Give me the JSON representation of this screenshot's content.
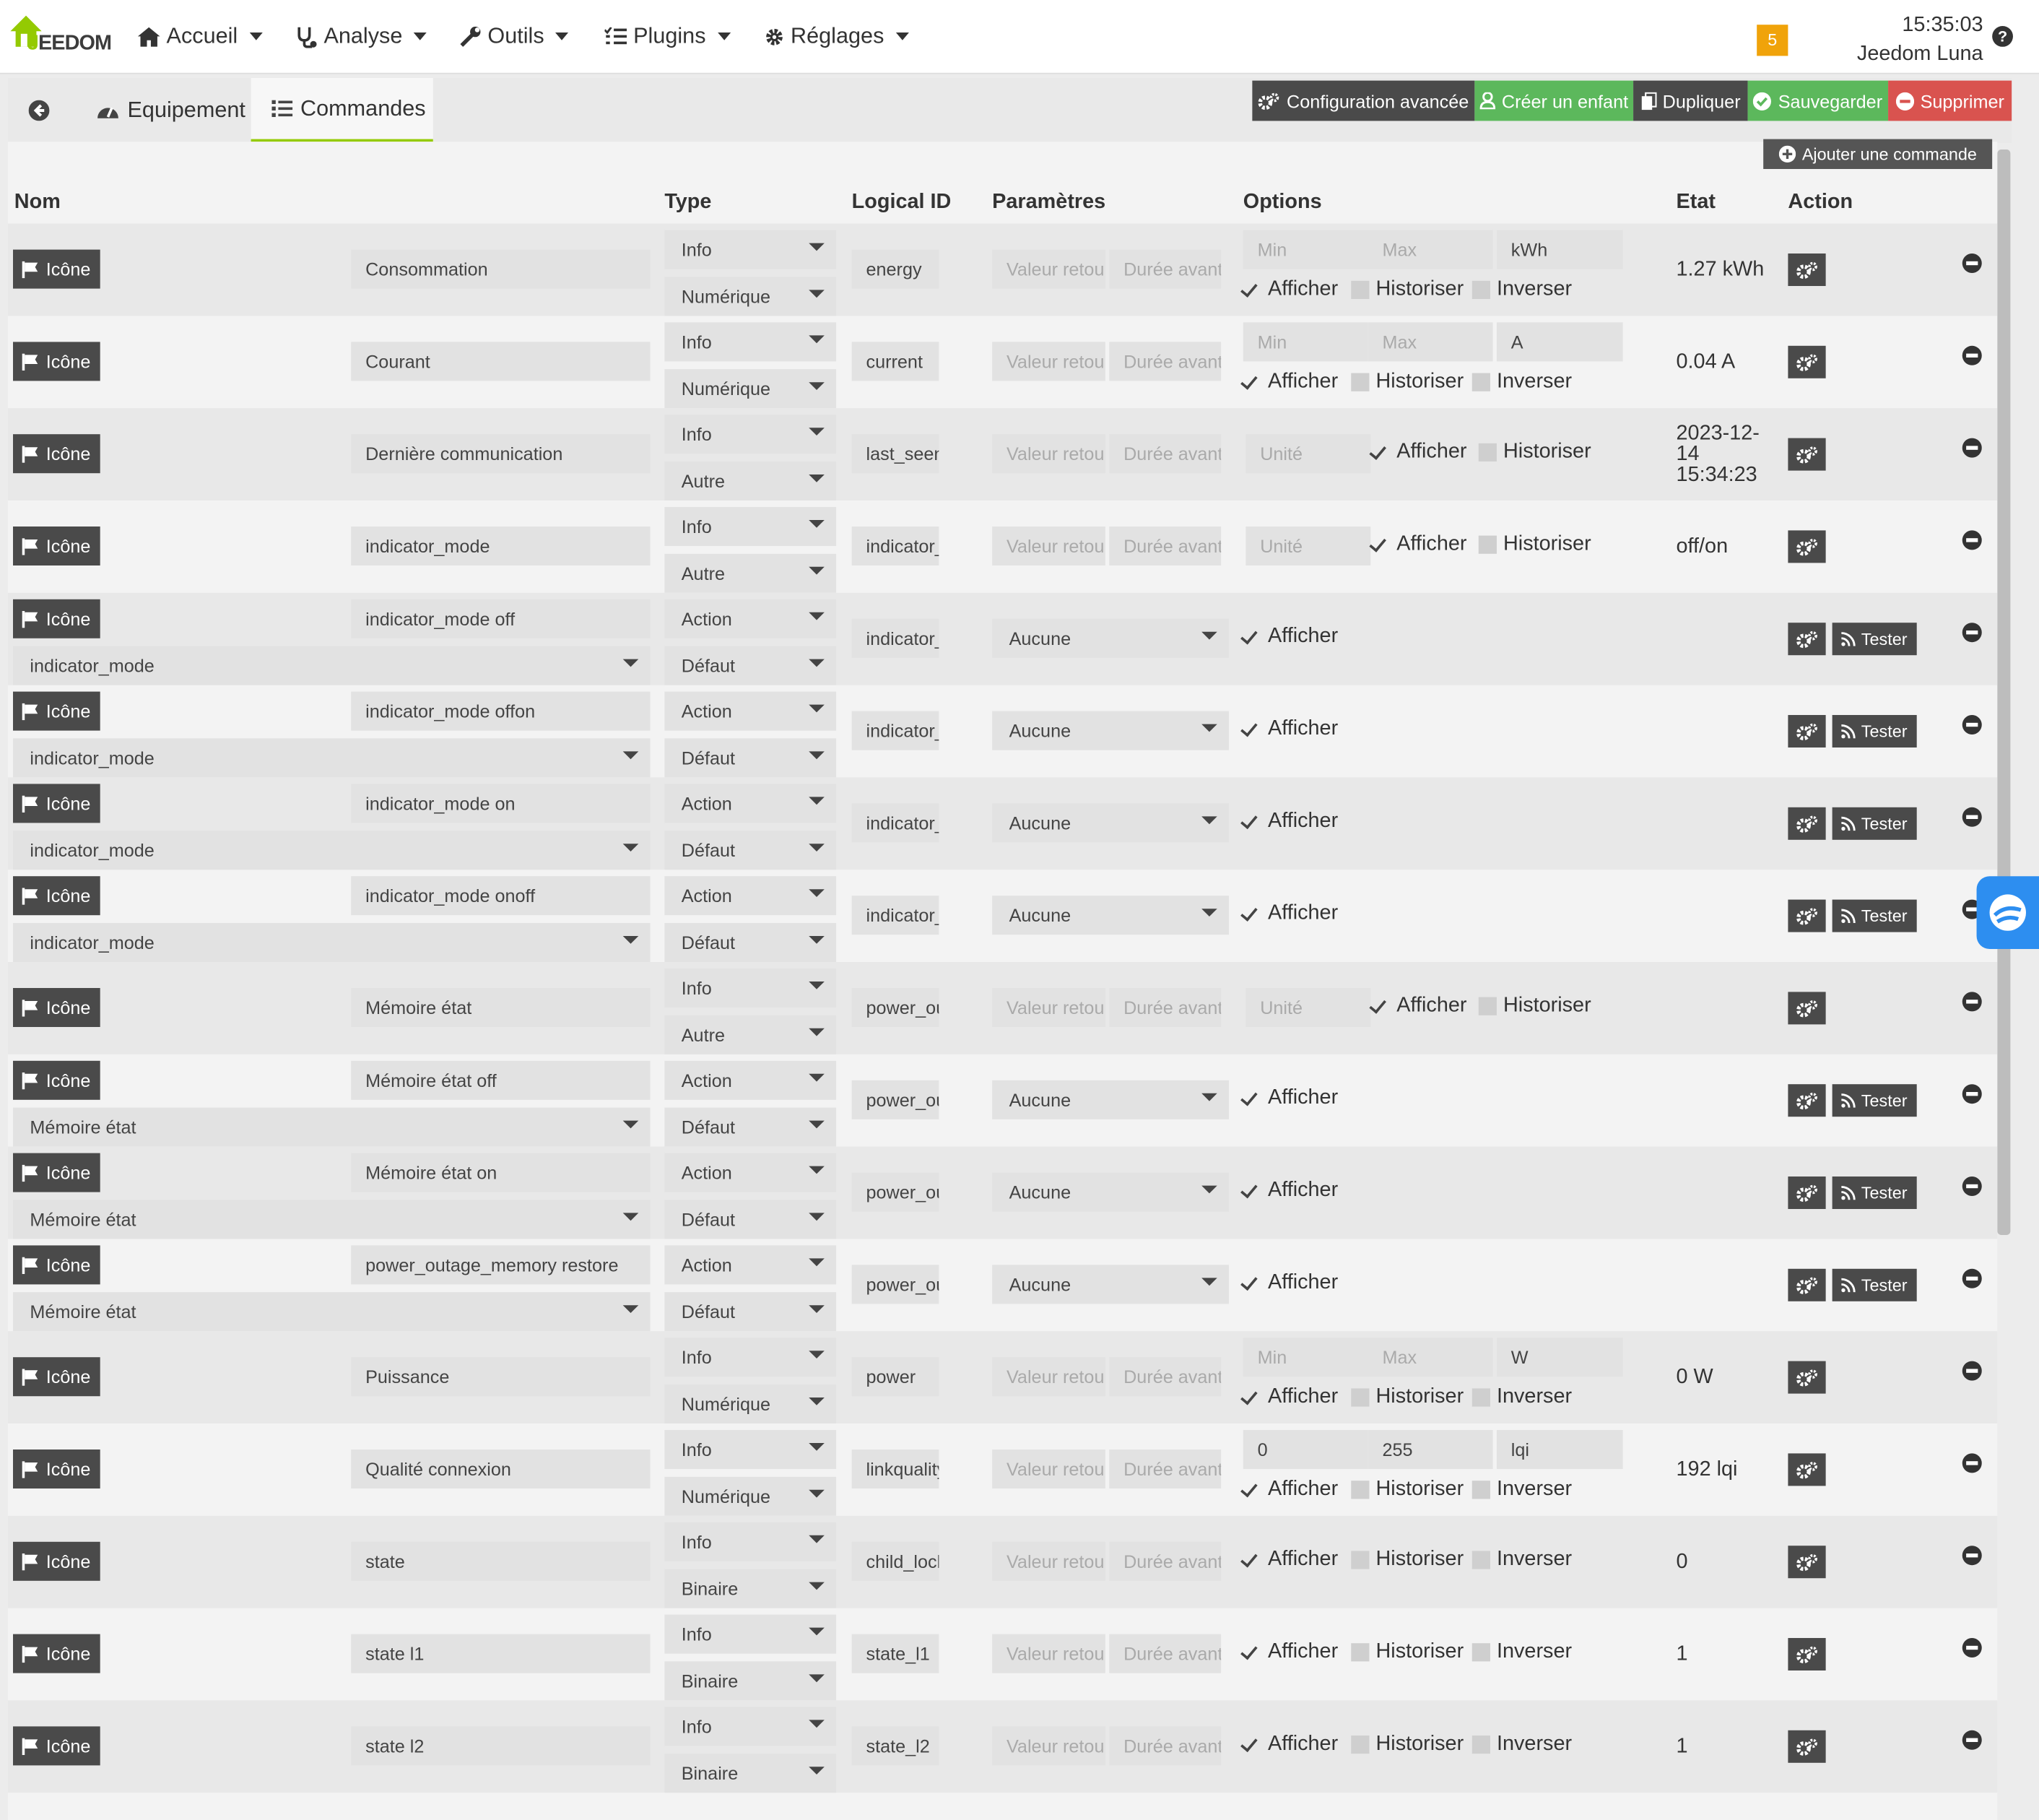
{
  "app": {
    "logo_text_j": "J",
    "logo_text_rest": "EEDOM"
  },
  "nav": [
    {
      "label": "Accueil",
      "icon": "home-icon"
    },
    {
      "label": "Analyse",
      "icon": "stethoscope-icon"
    },
    {
      "label": "Outils",
      "icon": "wrench-icon"
    },
    {
      "label": "Plugins",
      "icon": "tasks-icon"
    },
    {
      "label": "Réglages",
      "icon": "gear-icon"
    }
  ],
  "header": {
    "badge_count": "5",
    "time": "15:35:03",
    "user": "Jeedom Luna",
    "help": "?"
  },
  "tabs": {
    "equipement": "Equipement",
    "commandes": "Commandes"
  },
  "toolbar": {
    "config": "Configuration avancée",
    "child": "Créer un enfant",
    "duplicate": "Dupliquer",
    "save": "Sauvegarder",
    "delete": "Supprimer",
    "add_command": "Ajouter une commande"
  },
  "columns": {
    "nom": "Nom",
    "type": "Type",
    "logical_id": "Logical ID",
    "params": "Paramètres",
    "options": "Options",
    "etat": "Etat",
    "action": "Action"
  },
  "labels": {
    "icon_btn": "Icône",
    "value_return": "Valeur retour",
    "duration": "Durée avant",
    "min": "Min",
    "max": "Max",
    "unit": "Unité",
    "afficher": "Afficher",
    "historiser": "Historiser",
    "inverser": "Inverser",
    "tester": "Tester",
    "aucune": "Aucune"
  },
  "rows": [
    {
      "name": "Consommation",
      "type": "Info",
      "subtype": "Numérique",
      "logical_id": "energy",
      "kind": "num",
      "min": "",
      "max": "",
      "unit": "kWh",
      "state": "1.27 kWh"
    },
    {
      "name": "Courant",
      "type": "Info",
      "subtype": "Numérique",
      "logical_id": "current",
      "kind": "num",
      "min": "",
      "max": "",
      "unit": "A",
      "state": "0.04 A"
    },
    {
      "name": "Dernière communication",
      "type": "Info",
      "subtype": "Autre",
      "logical_id": "last_seen",
      "kind": "other",
      "state": "2023-12-14 15:34:23"
    },
    {
      "name": "indicator_mode",
      "type": "Info",
      "subtype": "Autre",
      "logical_id": "indicator_mode",
      "kind": "other",
      "state": "off/on"
    },
    {
      "name": "indicator_mode off",
      "type": "Action",
      "subtype": "Défaut",
      "logical_id": "indicator_mode",
      "kind": "action",
      "linked": "indicator_mode"
    },
    {
      "name": "indicator_mode offon",
      "type": "Action",
      "subtype": "Défaut",
      "logical_id": "indicator_mode",
      "kind": "action",
      "linked": "indicator_mode"
    },
    {
      "name": "indicator_mode on",
      "type": "Action",
      "subtype": "Défaut",
      "logical_id": "indicator_mode",
      "kind": "action",
      "linked": "indicator_mode"
    },
    {
      "name": "indicator_mode onoff",
      "type": "Action",
      "subtype": "Défaut",
      "logical_id": "indicator_mode",
      "kind": "action",
      "linked": "indicator_mode"
    },
    {
      "name": "Mémoire état",
      "type": "Info",
      "subtype": "Autre",
      "logical_id": "power_outage_memory",
      "kind": "other",
      "state": ""
    },
    {
      "name": "Mémoire état off",
      "type": "Action",
      "subtype": "Défaut",
      "logical_id": "power_outage_memory",
      "kind": "action",
      "linked": "Mémoire état"
    },
    {
      "name": "Mémoire état on",
      "type": "Action",
      "subtype": "Défaut",
      "logical_id": "power_outage_memory",
      "kind": "action",
      "linked": "Mémoire état"
    },
    {
      "name": "power_outage_memory restore",
      "type": "Action",
      "subtype": "Défaut",
      "logical_id": "power_outage_memory",
      "kind": "action",
      "linked": "Mémoire état"
    },
    {
      "name": "Puissance",
      "type": "Info",
      "subtype": "Numérique",
      "logical_id": "power",
      "kind": "num",
      "min": "",
      "max": "",
      "unit": "W",
      "state": "0 W"
    },
    {
      "name": "Qualité connexion",
      "type": "Info",
      "subtype": "Numérique",
      "logical_id": "linkquality",
      "kind": "num",
      "min": "0",
      "max": "255",
      "unit": "lqi",
      "state": "192 lqi"
    },
    {
      "name": "state",
      "type": "Info",
      "subtype": "Binaire",
      "logical_id": "child_lock",
      "kind": "bin",
      "state": "0"
    },
    {
      "name": "state l1",
      "type": "Info",
      "subtype": "Binaire",
      "logical_id": "state_l1",
      "kind": "bin",
      "state": "1"
    },
    {
      "name": "state l2",
      "type": "Info",
      "subtype": "Binaire",
      "logical_id": "state_l2",
      "kind": "bin",
      "state": "1"
    }
  ],
  "colors": {
    "green": "#5cb85c",
    "red": "#d9534f",
    "dark": "#4a4a4a",
    "accent": "#94ca02",
    "badge": "#f0a30a"
  }
}
